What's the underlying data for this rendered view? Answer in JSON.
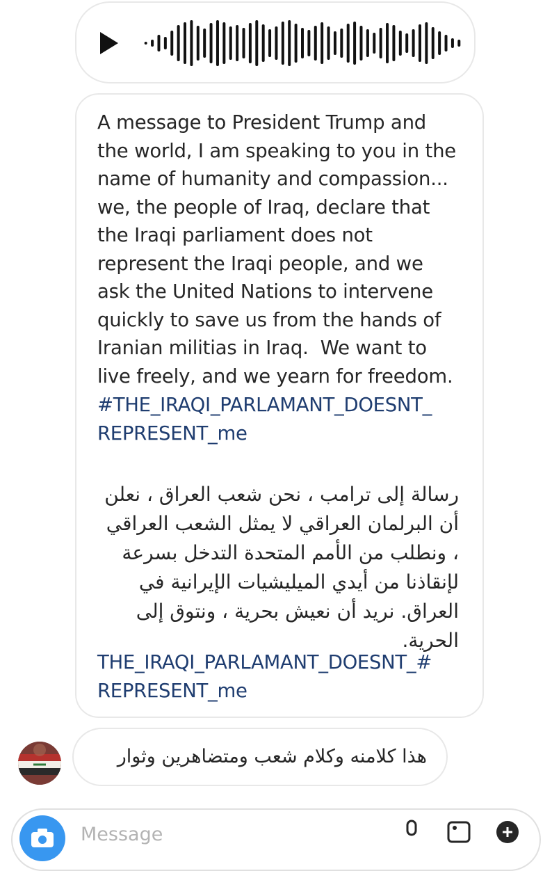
{
  "voice_message": {
    "waveform_bars": [
      4,
      10,
      24,
      18,
      36,
      52,
      60,
      66,
      50,
      42,
      58,
      66,
      60,
      48,
      52,
      44,
      58,
      66,
      54,
      40,
      48,
      62,
      66,
      56,
      44,
      38,
      50,
      60,
      48,
      34,
      42,
      56,
      62,
      50,
      40,
      30,
      44,
      58,
      52,
      36,
      28,
      40,
      54,
      60,
      46,
      34,
      24,
      14,
      10
    ]
  },
  "message": {
    "english": "A message to President Trump and\nthe world, I am speaking to you in the\nname of humanity and compassion...\nwe, the people of Iraq, declare that\nthe Iraqi parliament does not\nrepresent the Iraqi people, and we\nask the United Nations to intervene\nquickly to save us from the hands of\nIranian militias in Iraq.  We want to\nlive freely, and we yearn for freedom.",
    "hashtag_en": "#THE_IRAQI_PARLAMANT_DOESNT_\nREPRESENT_me",
    "arabic": "رسالة إلى ترامب ، نحن شعب العراق ، نعلن أن البرلمان العراقي لا يمثل الشعب العراقي ، ونطلب من الأمم المتحدة التدخل بسرعة لإنقاذنا من أيدي الميليشيات الإيرانية في العراق. نريد أن نعيش بحرية ، ونتوق إلى الحرية.",
    "hashtag_ar": "THE_IRAQI_PARLAMANT_DOESNT_#\nREPRESENT_me"
  },
  "reply": {
    "text": "هذا كلامنه وكلام شعب ومتضاهرين وثوار"
  },
  "composer": {
    "placeholder": "Message"
  },
  "colors": {
    "hashtag": "#1f3d70",
    "camera": "#3897f0",
    "bubble_border": "#e8e8e8"
  }
}
